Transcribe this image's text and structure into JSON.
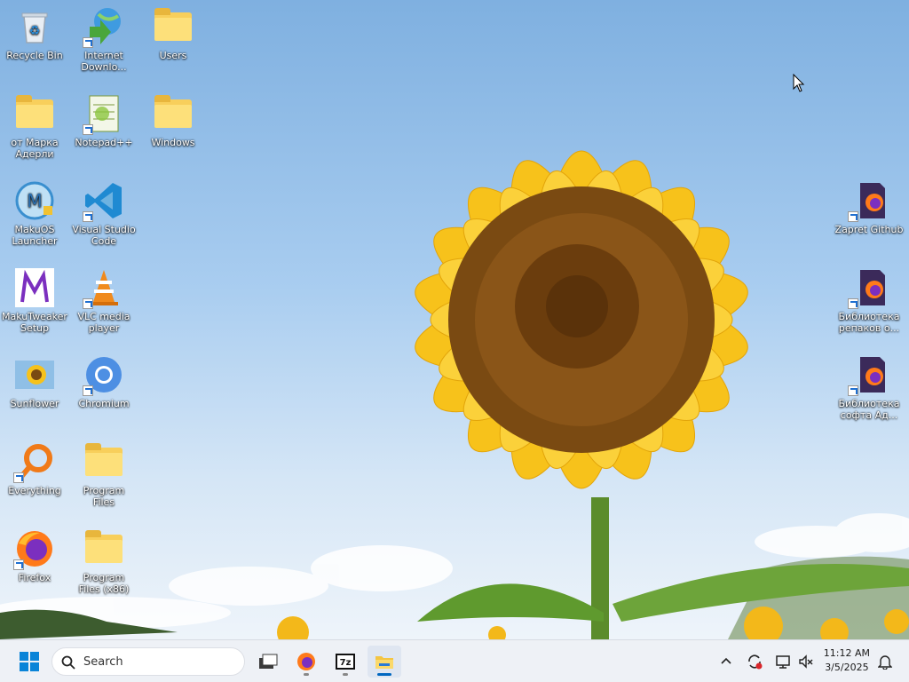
{
  "desktop": {
    "left_icons": [
      {
        "name": "recycle-bin",
        "label": "Recycle Bin",
        "shortcut": false
      },
      {
        "name": "internet-download-manager",
        "label": "Internet Downlo...",
        "shortcut": true
      },
      {
        "name": "users-folder",
        "label": "Users",
        "shortcut": false
      },
      {
        "name": "folder-ot-marka",
        "label": "от Марка Адерли",
        "shortcut": false
      },
      {
        "name": "notepad-plus-plus",
        "label": "Notepad++",
        "shortcut": true
      },
      {
        "name": "windows-folder",
        "label": "Windows",
        "shortcut": false
      },
      {
        "name": "makuos-launcher",
        "label": "MakuOS Launcher",
        "shortcut": false
      },
      {
        "name": "visual-studio-code",
        "label": "Visual Studio Code",
        "shortcut": true
      },
      {
        "name": "makutweaker-setup",
        "label": "MakuTweaker Setup",
        "shortcut": false
      },
      {
        "name": "vlc-media-player",
        "label": "VLC media player",
        "shortcut": true
      },
      {
        "name": "sunflower-image",
        "label": "Sunflower",
        "shortcut": false
      },
      {
        "name": "chromium",
        "label": "Chromium",
        "shortcut": true
      },
      {
        "name": "everything",
        "label": "Everything",
        "shortcut": true
      },
      {
        "name": "program-files-folder",
        "label": "Program Files",
        "shortcut": false
      },
      {
        "name": "firefox",
        "label": "Firefox",
        "shortcut": true
      },
      {
        "name": "program-files-x86-folder",
        "label": "Program Files (x86)",
        "shortcut": false
      }
    ],
    "right_icons": [
      {
        "name": "zapret-github",
        "label": "Zapret Github"
      },
      {
        "name": "repack-library",
        "label": "Библиотека репаков о..."
      },
      {
        "name": "software-library",
        "label": "Библиотека софта Ад..."
      }
    ]
  },
  "taskbar": {
    "search_placeholder": "Search",
    "pinned": [
      "task-view",
      "firefox",
      "7zip",
      "file-explorer"
    ],
    "time": "11:12 AM",
    "date": "3/5/2025"
  },
  "colors": {
    "taskbar_bg": "#eef1f6",
    "accent": "#0067c0",
    "folder": "#f8cf5b"
  }
}
